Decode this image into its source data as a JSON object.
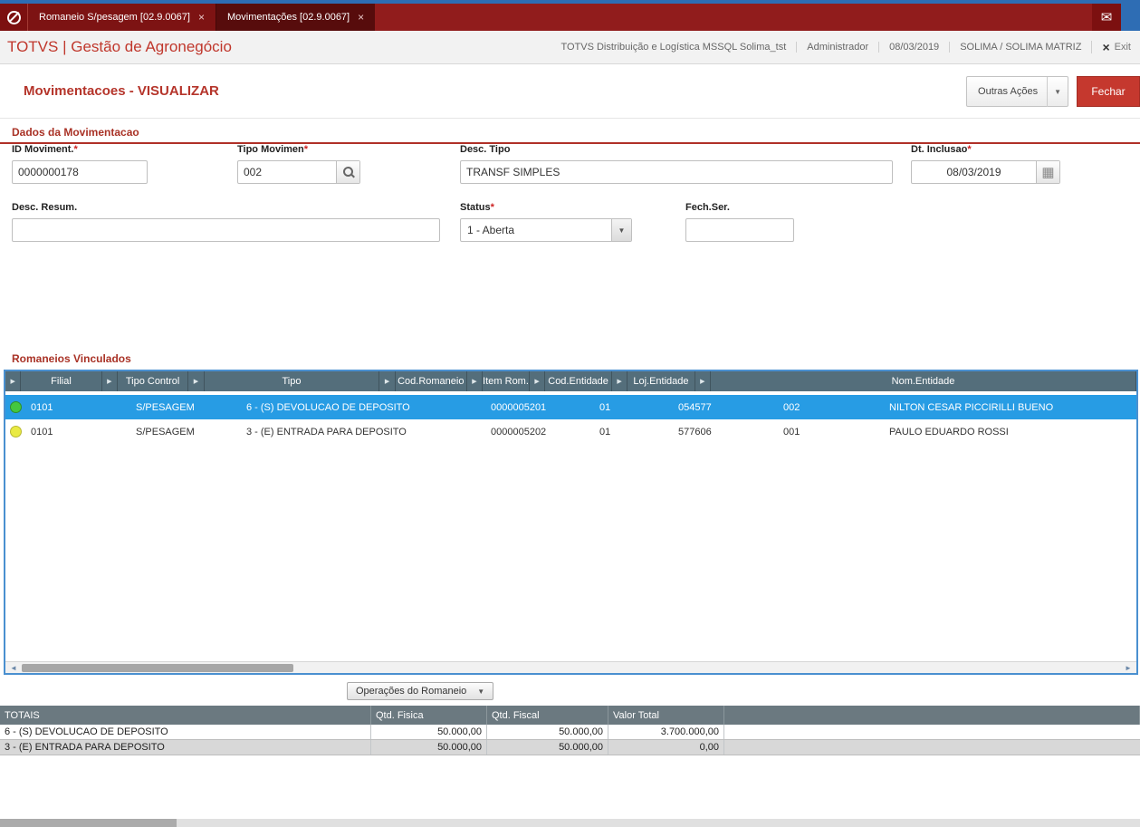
{
  "topbar": {
    "tabs": [
      {
        "label": "Romaneio S/pesagem [02.9.0067]",
        "close": "×"
      },
      {
        "label": "Movimentações [02.9.0067]",
        "close": "×"
      }
    ]
  },
  "header": {
    "brand": "TOTVS | Gestão de Agronegócio",
    "environment": "TOTVS Distribuição e Logística MSSQL Solima_tst",
    "user": "Administrador",
    "date": "08/03/2019",
    "company": "SOLIMA / SOLIMA MATRIZ",
    "exit_label": "Exit"
  },
  "page": {
    "title": "Movimentacoes - VISUALIZAR",
    "other_actions_label": "Outras Ações",
    "close_label": "Fechar"
  },
  "form": {
    "section_title": "Dados da Movimentacao",
    "fields": {
      "id_moviment": {
        "label": "ID Moviment.",
        "required": "*",
        "value": "0000000178"
      },
      "tipo_movimen": {
        "label": "Tipo Movimen",
        "required": "*",
        "value": "002"
      },
      "desc_tipo": {
        "label": "Desc. Tipo",
        "value": "TRANSF SIMPLES"
      },
      "dt_inclusao": {
        "label": "Dt. Inclusao",
        "required": "*",
        "value": "08/03/2019"
      },
      "desc_resum": {
        "label": "Desc. Resum.",
        "value": ""
      },
      "status": {
        "label": "Status",
        "required": "*",
        "value": "1 - Aberta"
      },
      "fech_ser": {
        "label": "Fech.Ser.",
        "value": ""
      }
    }
  },
  "grid": {
    "section_title": "Romaneios Vinculados",
    "columns": [
      "Filial",
      "Tipo Control",
      "Tipo",
      "Cod.Romaneio",
      "Item Rom.",
      "Cod.Entidade",
      "Loj.Entidade",
      "Nom.Entidade"
    ],
    "rows": [
      {
        "status": "green",
        "filial": "0101",
        "tipo_control": "S/PESAGEM",
        "tipo": "6 - (S) DEVOLUCAO DE DEPOSITO",
        "cod_romaneio": "0000005201",
        "item_rom": "01",
        "cod_entidade": "054577",
        "loj_entidade": "002",
        "nom_entidade": "NILTON CESAR PICCIRILLI BUENO",
        "selected": true
      },
      {
        "status": "yellow",
        "filial": "0101",
        "tipo_control": "S/PESAGEM",
        "tipo": "3 - (E) ENTRADA PARA DEPOSITO",
        "cod_romaneio": "0000005202",
        "item_rom": "01",
        "cod_entidade": "577606",
        "loj_entidade": "001",
        "nom_entidade": "PAULO EDUARDO ROSSI",
        "selected": false
      }
    ],
    "operations_button_label": "Operações do Romaneio"
  },
  "totals": {
    "headers": [
      "TOTAIS",
      "Qtd. Fisica",
      "Qtd. Fiscal",
      "Valor Total"
    ],
    "rows": [
      {
        "label": "6 - (S) DEVOLUCAO DE DEPOSITO",
        "qtd_fisica": "50.000,00",
        "qtd_fiscal": "50.000,00",
        "valor_total": "3.700.000,00"
      },
      {
        "label": "3 - (E) ENTRADA PARA DEPOSITO",
        "qtd_fisica": "50.000,00",
        "qtd_fiscal": "50.000,00",
        "valor_total": "0,00"
      }
    ]
  },
  "icons": {
    "mail": "✉",
    "calendar": "▦",
    "dropdown_arrow": "▼",
    "column_arrow": "▶",
    "scroll_left": "◄",
    "scroll_right": "►",
    "exit_x": "×"
  },
  "colors": {
    "topbar_red": "#911c1c",
    "tab_active_red": "#570c0c",
    "brand_red": "#c0372c",
    "button_red": "#c5382e",
    "grid_header": "#546e7b",
    "selected_row_blue": "#279ce4",
    "totals_header": "#6b7980",
    "status_green": "#44c73f",
    "status_yellow": "#e9ea43",
    "accent_blue": "#2e6db4"
  }
}
